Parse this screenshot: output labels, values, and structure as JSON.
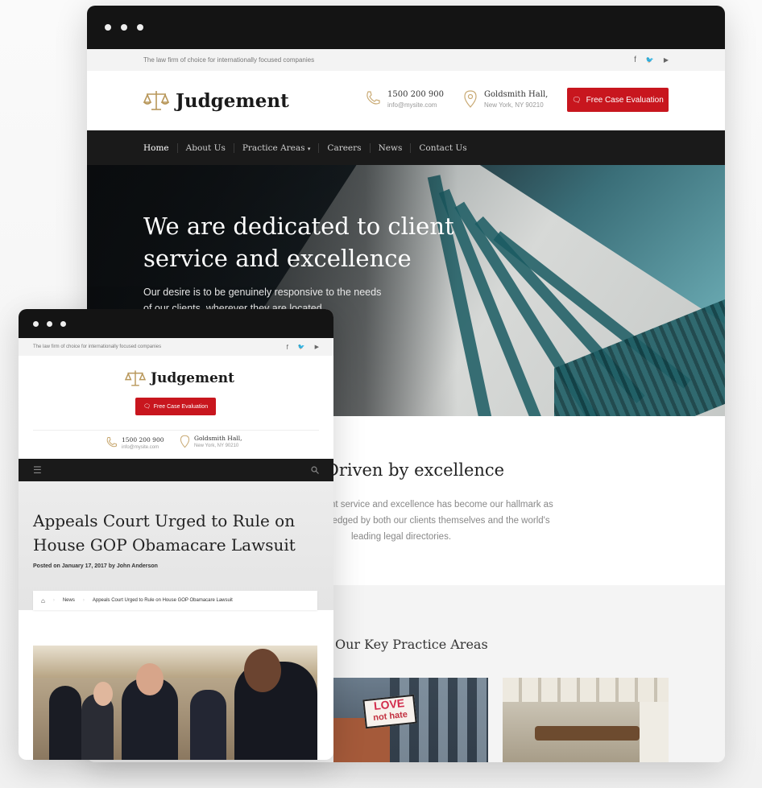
{
  "desktop": {
    "tagline": "The law firm of choice for internationally focused companies",
    "social": {
      "facebook": "f",
      "twitter": "🐦",
      "youtube": "▶"
    },
    "logo": "Judgement",
    "phone": {
      "number": "1500 200 900",
      "email": "info@mysite.com"
    },
    "address": {
      "line1": "Goldsmith Hall,",
      "line2": "New York, NY 90210"
    },
    "cta": "Free Case Evaluation",
    "nav": [
      "Home",
      "About Us",
      "Practice Areas",
      "Careers",
      "News",
      "Contact Us"
    ],
    "hero": {
      "title_line1": "We are dedicated to client",
      "title_line2": "service and excellence",
      "text_line1": "Our desire is to be genuinely responsive to the needs",
      "text_line2": "of our clients, wherever they are located."
    },
    "section": {
      "title": "Driven by excellence",
      "text_line1": "nt service and excellence has become our hallmark as",
      "text_line2": "ledged by both our clients themselves and the world's",
      "text_line3": "leading legal directories."
    },
    "practice": {
      "title": "Our Key Practice Areas",
      "sign_line1": "LOVE",
      "sign_line2": "not hate"
    }
  },
  "mobile": {
    "tagline": "The law firm of choice for internationally focused companies",
    "logo": "Judgement",
    "cta": "Free Case Evaluation",
    "phone": {
      "number": "1500 200 900",
      "email": "info@mysite.com"
    },
    "address": {
      "line1": "Goldsmith Hall,",
      "line2": "New York, NY 90210"
    },
    "article": {
      "title_line1": "Appeals Court Urged to Rule on",
      "title_line2": "House GOP Obamacare Lawsuit",
      "meta": "Posted on January 17, 2017 by John Anderson"
    },
    "breadcrumb": {
      "home_icon": "home-icon",
      "section": "News",
      "current": "Appeals Court Urged to Rule on House GOP Obamacare Lawsuit"
    }
  },
  "colors": {
    "accent": "#c8161e",
    "gold": "#b8975a",
    "dark": "#141414"
  }
}
